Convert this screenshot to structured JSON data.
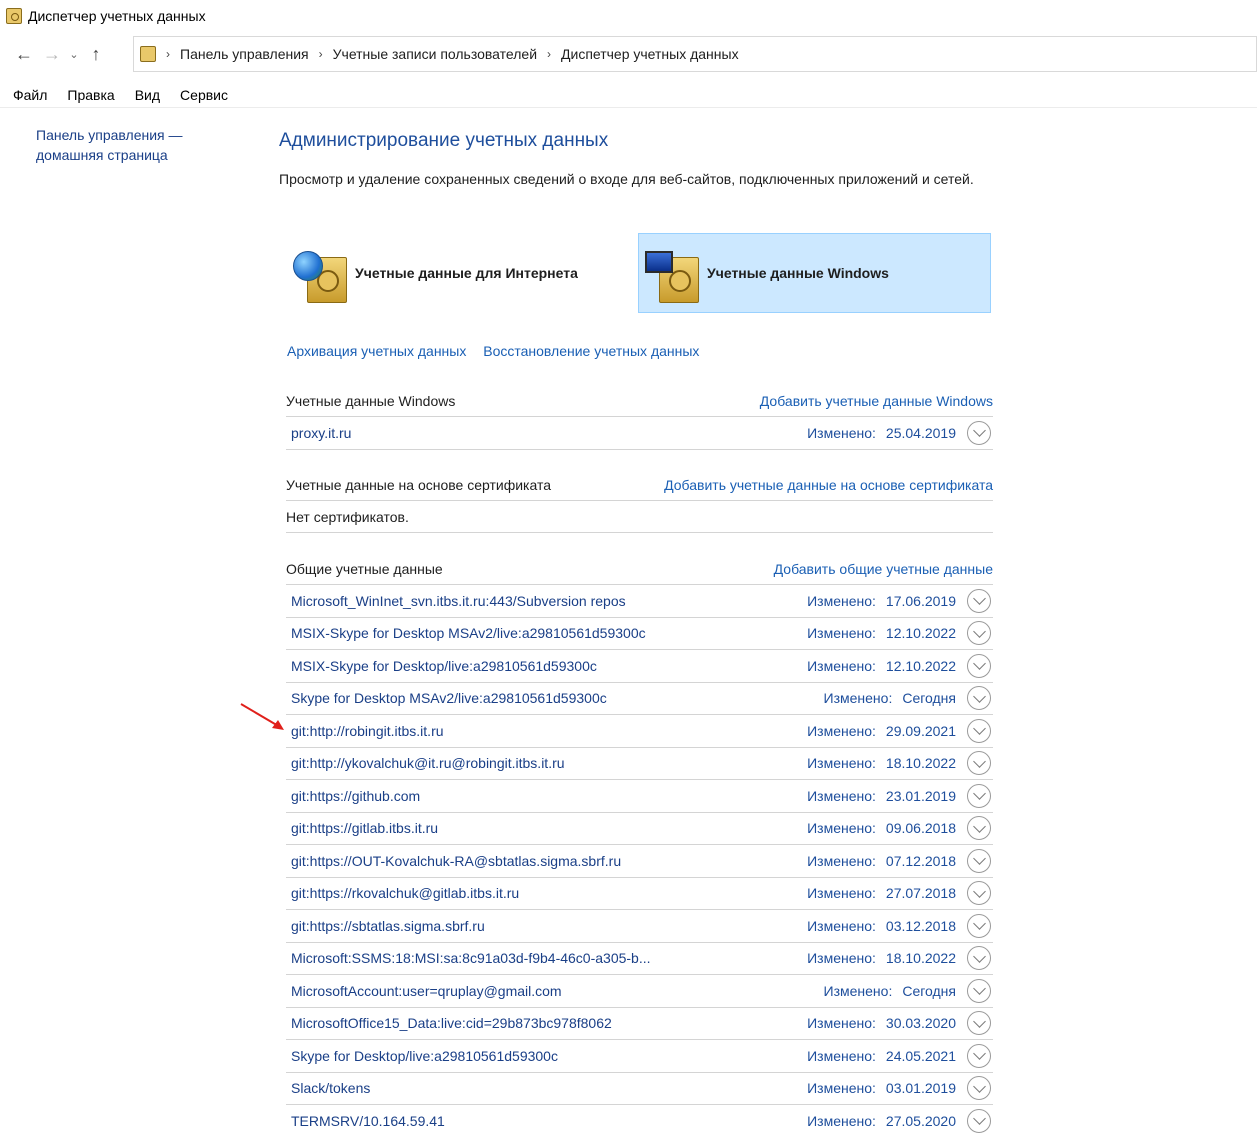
{
  "window": {
    "title": "Диспетчер учетных данных"
  },
  "breadcrumb": [
    "Панель управления",
    "Учетные записи пользователей",
    "Диспетчер учетных данных"
  ],
  "menu": [
    "Файл",
    "Правка",
    "Вид",
    "Сервис"
  ],
  "leftnav": {
    "home_link": "Панель управления — домашняя страница"
  },
  "main": {
    "heading": "Администрирование учетных данных",
    "description": "Просмотр и удаление сохраненных сведений о входе для веб-сайтов, подключенных приложений и сетей."
  },
  "tiles": {
    "web": "Учетные данные для Интернета",
    "windows": "Учетные данные Windows"
  },
  "links": {
    "backup": "Архивация учетных данных",
    "restore": "Восстановление учетных данных"
  },
  "windows_section": {
    "title": "Учетные данные Windows",
    "add": "Добавить учетные данные Windows",
    "items": [
      {
        "name": "proxy.it.ru",
        "label": "Изменено:",
        "date": "25.04.2019"
      }
    ]
  },
  "cert_section": {
    "title": "Учетные данные на основе сертификата",
    "add": "Добавить учетные данные на основе сертификата",
    "empty": "Нет сертификатов."
  },
  "generic_section": {
    "title": "Общие учетные данные",
    "add": "Добавить общие учетные данные",
    "items": [
      {
        "name": "Microsoft_WinInet_svn.itbs.it.ru:443/Subversion repos",
        "label": "Изменено:",
        "date": "17.06.2019"
      },
      {
        "name": "MSIX-Skype for Desktop MSAv2/live:a29810561d59300c",
        "label": "Изменено:",
        "date": "12.10.2022"
      },
      {
        "name": "MSIX-Skype for Desktop/live:a29810561d59300c",
        "label": "Изменено:",
        "date": "12.10.2022"
      },
      {
        "name": "Skype for Desktop MSAv2/live:a29810561d59300c",
        "label": "Изменено:",
        "date": "Сегодня"
      },
      {
        "name": "git:http://robingit.itbs.it.ru",
        "label": "Изменено:",
        "date": "29.09.2021"
      },
      {
        "name": "git:http://ykovalchuk@it.ru@robingit.itbs.it.ru",
        "label": "Изменено:",
        "date": "18.10.2022"
      },
      {
        "name": "git:https://github.com",
        "label": "Изменено:",
        "date": "23.01.2019"
      },
      {
        "name": "git:https://gitlab.itbs.it.ru",
        "label": "Изменено:",
        "date": "09.06.2018"
      },
      {
        "name": "git:https://OUT-Kovalchuk-RA@sbtatlas.sigma.sbrf.ru",
        "label": "Изменено:",
        "date": "07.12.2018"
      },
      {
        "name": "git:https://rkovalchuk@gitlab.itbs.it.ru",
        "label": "Изменено:",
        "date": "27.07.2018"
      },
      {
        "name": "git:https://sbtatlas.sigma.sbrf.ru",
        "label": "Изменено:",
        "date": "03.12.2018"
      },
      {
        "name": "Microsoft:SSMS:18:MSI:sa:8c91a03d-f9b4-46c0-a305-b...",
        "label": "Изменено:",
        "date": "18.10.2022"
      },
      {
        "name": "MicrosoftAccount:user=qruplay@gmail.com",
        "label": "Изменено:",
        "date": "Сегодня"
      },
      {
        "name": "MicrosoftOffice15_Data:live:cid=29b873bc978f8062",
        "label": "Изменено:",
        "date": "30.03.2020"
      },
      {
        "name": "Skype for Desktop/live:a29810561d59300c",
        "label": "Изменено:",
        "date": "24.05.2021"
      },
      {
        "name": "Slack/tokens",
        "label": "Изменено:",
        "date": "03.01.2019"
      },
      {
        "name": "TERMSRV/10.164.59.41",
        "label": "Изменено:",
        "date": "27.05.2020"
      }
    ]
  },
  "colors": {
    "link": "#1a5fb4",
    "heading": "#1e4e9c",
    "selected_tile": "#cce8ff",
    "annotation_arrow": "#e0201b"
  },
  "icons": [
    "back-arrow-icon",
    "forward-arrow-icon",
    "recent-dropdown-icon",
    "up-arrow-icon",
    "credential-manager-icon",
    "globe-safe-icon",
    "monitor-safe-icon",
    "expand-chevron-icon",
    "annotation-arrow-icon"
  ]
}
